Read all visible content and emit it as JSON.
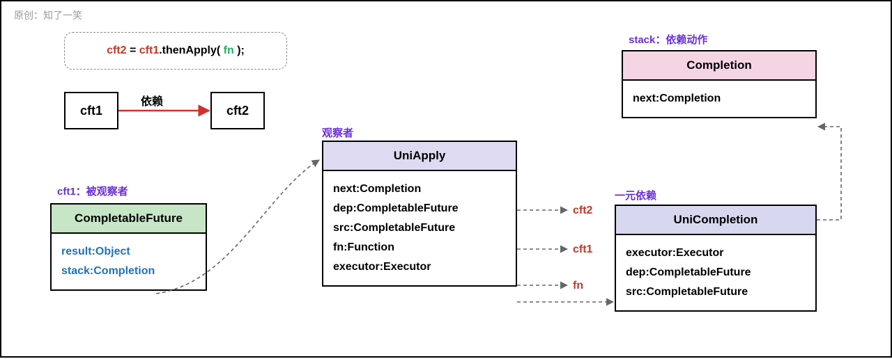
{
  "watermark": "原创：知了一笑",
  "code": {
    "cft2": "cft2",
    "eq": " = ",
    "cft1": "cft1",
    "then": ".thenApply( ",
    "fn": "fn",
    "close": " );"
  },
  "nodes": {
    "cft1": "cft1",
    "cft2": "cft2",
    "dep": "依赖"
  },
  "labels": {
    "cft1": "cft1：被观察者",
    "observer": "观察者",
    "stack": "stack：依赖动作",
    "unary": "一元依赖"
  },
  "cf": {
    "title": "CompletableFuture",
    "f1": "result:Object",
    "f2": "stack:Completion"
  },
  "ua": {
    "title": "UniApply",
    "f1": "next:Completion",
    "f2": "dep:CompletableFuture",
    "f3": "src:CompletableFuture",
    "f4": "fn:Function",
    "f5": "executor:Executor"
  },
  "co": {
    "title": "Completion",
    "f1": "next:Completion"
  },
  "uc": {
    "title": "UniCompletion",
    "f1": "executor:Executor",
    "f2": "dep:CompletableFuture",
    "f3": "src:CompletableFuture"
  },
  "refs": {
    "cft2": "cft2",
    "cft1": "cft1",
    "fn": "fn"
  }
}
